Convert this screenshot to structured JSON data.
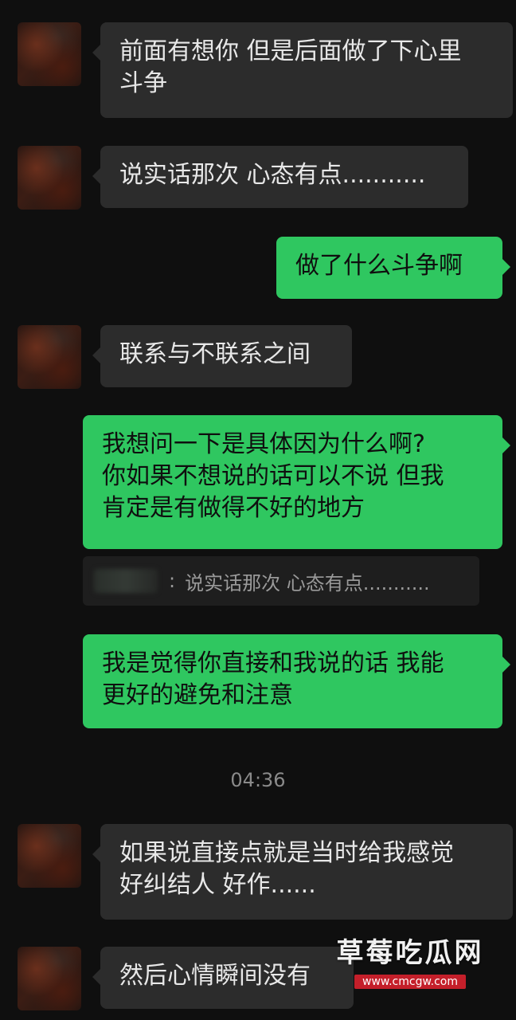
{
  "messages": [
    {
      "side": "in",
      "text": "前面有想你 但是后面做了下心里\n斗争"
    },
    {
      "side": "in",
      "text": "说实话那次 心态有点..........."
    },
    {
      "side": "out",
      "text": "做了什么斗争啊"
    },
    {
      "side": "in",
      "text": "联系与不联系之间"
    },
    {
      "side": "out",
      "text": "我想问一下是具体因为什么啊?\n你如果不想说的话可以不说 但我\n肯定是有做得不好的地方"
    },
    {
      "side": "out",
      "text": "我是觉得你直接和我说的话 我能\n更好的避免和注意"
    },
    {
      "side": "in",
      "text": "如果说直接点就是当时给我感觉\n好纠结人 好作......"
    },
    {
      "side": "in",
      "text": "然后心情瞬间没有"
    }
  ],
  "quote": {
    "separator": ":",
    "text": "说实话那次 心态有点..........."
  },
  "timestamp": "04:36",
  "watermark": {
    "title": "草莓吃瓜网",
    "url": "www.cmcgw.com"
  },
  "colors": {
    "background": "#0f0f0f",
    "incoming_bubble": "#2c2c2c",
    "outgoing_bubble": "#2fc760"
  },
  "icons": {
    "avatar": "contact-avatar"
  }
}
